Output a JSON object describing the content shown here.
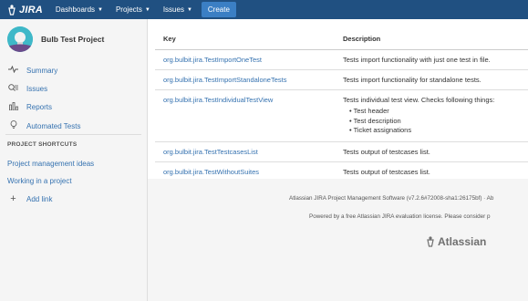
{
  "topbar": {
    "logo_text": "JIRA",
    "nav": [
      {
        "label": "Dashboards"
      },
      {
        "label": "Projects"
      },
      {
        "label": "Issues"
      }
    ],
    "create_label": "Create"
  },
  "sidebar": {
    "project_name": "Bulb Test Project",
    "items": [
      {
        "label": "Summary",
        "icon": "pulse-icon"
      },
      {
        "label": "Issues",
        "icon": "issues-icon"
      },
      {
        "label": "Reports",
        "icon": "reports-icon"
      },
      {
        "label": "Automated Tests",
        "icon": "bulb-icon"
      }
    ],
    "shortcuts_heading": "PROJECT SHORTCUTS",
    "shortcuts": [
      {
        "label": "Project management ideas"
      },
      {
        "label": "Working in a project"
      }
    ],
    "add_link_label": "Add link"
  },
  "table": {
    "headers": {
      "key": "Key",
      "description": "Description"
    },
    "rows": [
      {
        "key": "org.bulbit.jira.TestImportOneTest",
        "description": "Tests import functionality with just one test in file."
      },
      {
        "key": "org.bulbit.jira.TestImportStandaloneTests",
        "description": "Tests import functionality for standalone tests."
      },
      {
        "key": "org.bulbit.jira.TestIndividualTestView",
        "description": "Tests individual test view. Checks following things:",
        "bullets": [
          "Test header",
          "Test description",
          "Ticket assignations"
        ]
      },
      {
        "key": "org.bulbit.jira.TestTestcasesList",
        "description": "Tests output of testcases list."
      },
      {
        "key": "org.bulbit.jira.TestWithoutSuites",
        "description": "Tests output of testcases list."
      }
    ]
  },
  "footer": {
    "line1": "Atlassian JIRA Project Management Software (v7.2.6#72008-sha1:26175bf)  ·  Ab",
    "line2": "Powered by a free Atlassian JIRA evaluation license. Please consider p",
    "brand": "Atlassian"
  },
  "colors": {
    "nav_bg": "#205081",
    "link": "#3572b0",
    "create_btn": "#3b7fc4"
  }
}
